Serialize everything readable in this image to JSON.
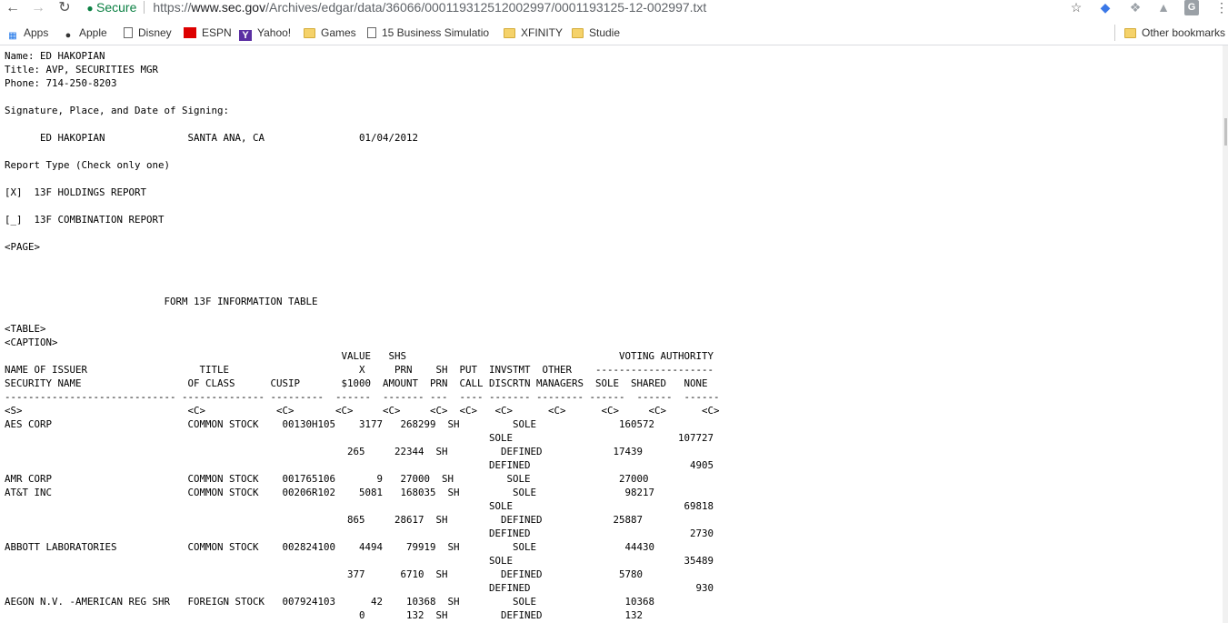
{
  "toolbar": {
    "back_icon": "arrow-left",
    "forward_icon": "arrow-right",
    "reload_icon": "reload",
    "secure_label": "Secure",
    "url_prefix": "https://",
    "url_host": "www.sec.gov",
    "url_path": "/Archives/edgar/data/36066/000119312512002997/0001193125-12-002997.txt",
    "extensions": [
      "bookmark-star-icon",
      "gem-extension-icon",
      "dropbox-icon",
      "google-drive-icon",
      "g-extension-icon"
    ]
  },
  "bookmarks": [
    {
      "label": "Apps",
      "icon": "apps-grid"
    },
    {
      "label": "Apple",
      "icon": "apple-logo"
    },
    {
      "label": "Disney",
      "icon": "page"
    },
    {
      "label": "ESPN",
      "icon": "espn-logo"
    },
    {
      "label": "Yahoo!",
      "icon": "yahoo-logo"
    },
    {
      "label": "Games",
      "icon": "folder"
    },
    {
      "label": "15 Business Simulatio",
      "icon": "page"
    },
    {
      "label": "XFINITY",
      "icon": "folder"
    },
    {
      "label": "Studie",
      "icon": "folder"
    },
    {
      "label": "Other bookmarks",
      "icon": "folder"
    }
  ],
  "document": {
    "lines": [
      "Name: ED HAKOPIAN",
      "Title: AVP, SECURITIES MGR",
      "Phone: 714-250-8203",
      "",
      "Signature, Place, and Date of Signing:",
      "",
      "      ED HAKOPIAN              SANTA ANA, CA                01/04/2012",
      "",
      "Report Type (Check only one)",
      "",
      "[X]  13F HOLDINGS REPORT",
      "",
      "[_]  13F COMBINATION REPORT",
      "",
      "<PAGE>",
      "",
      "",
      "",
      "                           FORM 13F INFORMATION TABLE",
      "",
      "<TABLE>",
      "<CAPTION>",
      "                                                         VALUE   SHS                                    VOTING AUTHORITY",
      "NAME OF ISSUER                   TITLE                      X     PRN    SH  PUT  INVSTMT  OTHER    --------------------",
      "SECURITY NAME                  OF CLASS      CUSIP       $1000  AMOUNT  PRN  CALL DISCRTN MANAGERS  SOLE  SHARED   NONE",
      "----------------------------- -------------- ---------  ------  ------- ---  ---- ------- -------- ------  ------  ------",
      "<S>                            <C>            <C>       <C>     <C>     <C>  <C>   <C>      <C>      <C>     <C>      <C>",
      "AES CORP                       COMMON STOCK    00130H105    3177   268299  SH         SOLE              160572",
      "                                                                                  SOLE                            107727",
      "                                                          265     22344  SH         DEFINED            17439",
      "                                                                                  DEFINED                           4905",
      "AMR CORP                       COMMON STOCK    001765106       9   27000  SH         SOLE               27000",
      "AT&T INC                       COMMON STOCK    00206R102    5081   168035  SH         SOLE               98217",
      "                                                                                  SOLE                             69818",
      "                                                          865     28617  SH         DEFINED            25887",
      "                                                                                  DEFINED                           2730",
      "ABBOTT LABORATORIES            COMMON STOCK    002824100    4494    79919  SH         SOLE               44430",
      "                                                                                  SOLE                             35489",
      "                                                          377      6710  SH         DEFINED             5780",
      "                                                                                  DEFINED                            930",
      "AEGON N.V. -AMERICAN REG SHR   FOREIGN STOCK   007924103      42    10368  SH         SOLE               10368",
      "                                                            0       132  SH         DEFINED              132"
    ]
  }
}
